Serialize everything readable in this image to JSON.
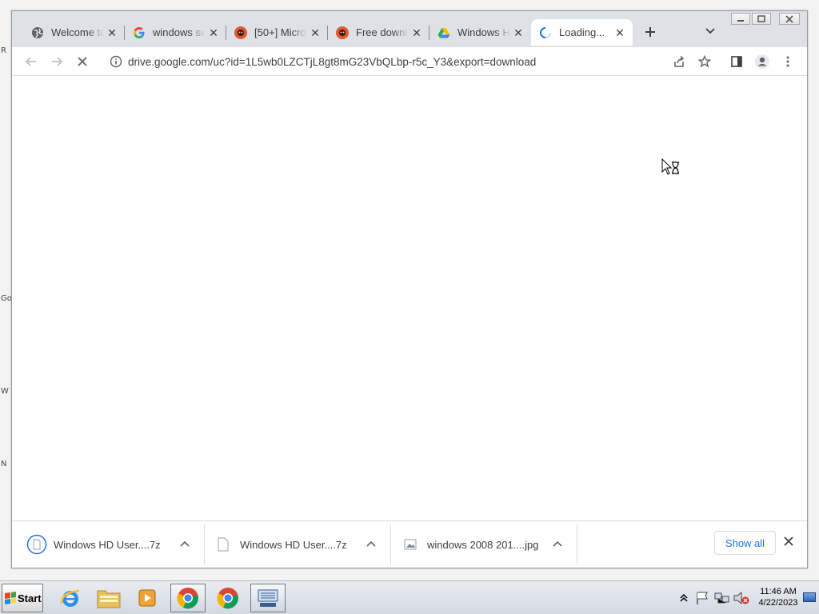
{
  "desktop": {
    "edge_letters": [
      "R",
      "Go",
      "W",
      "N"
    ]
  },
  "window": {
    "controls": [
      "minimize",
      "maximize",
      "close"
    ]
  },
  "tabs": [
    {
      "title": "Welcome to",
      "icon": "globe-icon"
    },
    {
      "title": "windows se",
      "icon": "google-icon"
    },
    {
      "title": "[50+] Micro",
      "icon": "monkey-icon"
    },
    {
      "title": "Free downlo",
      "icon": "monkey-icon"
    },
    {
      "title": "Windows H",
      "icon": "google-drive-icon"
    },
    {
      "title": "Loading...",
      "icon": "loading-spinner-icon",
      "active": true
    }
  ],
  "toolbar": {
    "url": "drive.google.com/uc?id=1L5wb0LZCTjL8gt8mG23VbQLbp-r5c_Y3&export=download"
  },
  "downloads": {
    "items": [
      {
        "name": "Windows HD User....7z",
        "icon": "download-progress-icon"
      },
      {
        "name": "Windows HD User....7z",
        "icon": "file-icon"
      },
      {
        "name": "windows 2008 201....jpg",
        "icon": "image-file-icon"
      }
    ],
    "show_all_label": "Show all"
  },
  "taskbar": {
    "start_label": "Start",
    "time": "11:46 AM",
    "date": "4/22/2023"
  },
  "colors": {
    "tab_strip": "#dee1e6",
    "link_blue": "#1a73e8"
  }
}
